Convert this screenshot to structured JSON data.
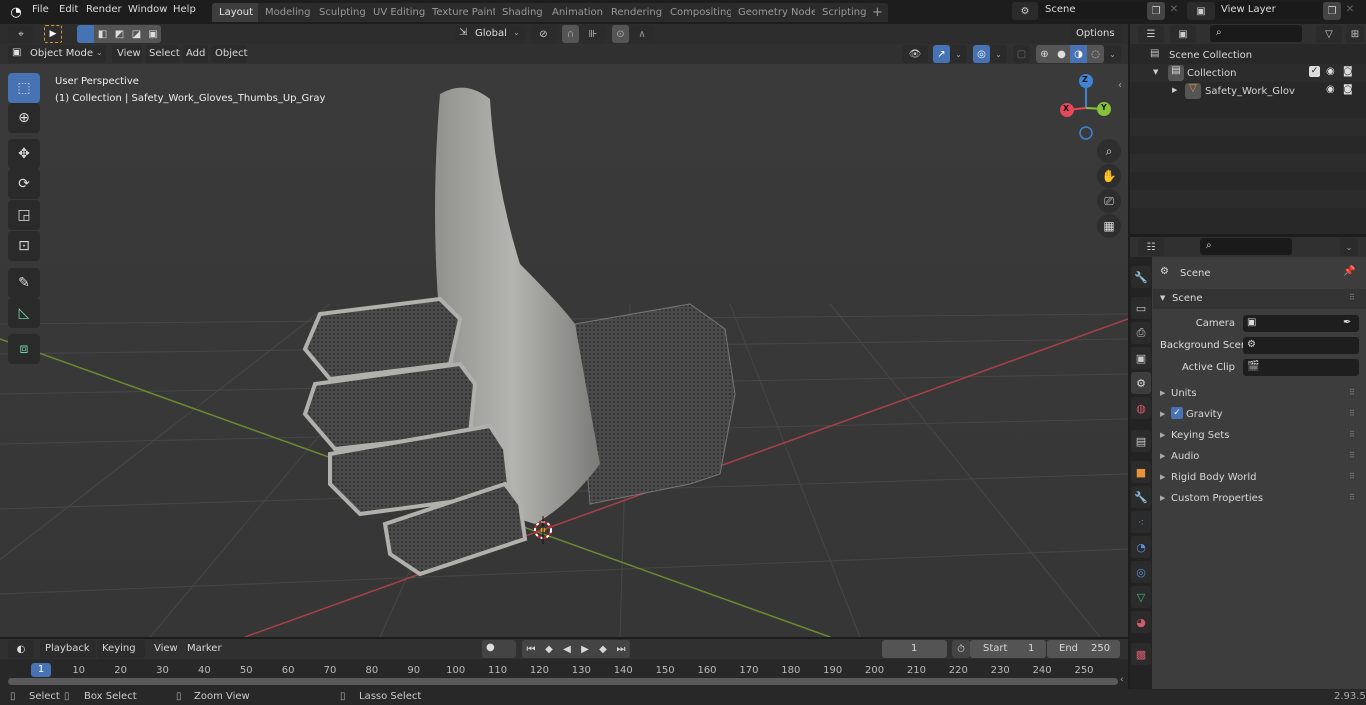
{
  "topbar": {
    "menus": [
      "File",
      "Edit",
      "Render",
      "Window",
      "Help"
    ],
    "workspaces": [
      "Layout",
      "Modeling",
      "Sculpting",
      "UV Editing",
      "Texture Paint",
      "Shading",
      "Animation",
      "Rendering",
      "Compositing",
      "Geometry Nodes",
      "Scripting"
    ],
    "active_workspace": "Layout",
    "add_workspace": "+",
    "scene_name": "Scene",
    "view_layer_name": "View Layer"
  },
  "viewport_header": {
    "mode": "Object Mode",
    "menus": [
      "View",
      "Select",
      "Add",
      "Object"
    ],
    "transform_orientation": "Global",
    "options_label": "Options"
  },
  "viewport": {
    "perspective_label": "User Perspective",
    "object_info": "(1) Collection | Safety_Work_Gloves_Thumbs_Up_Gray",
    "gizmo_axes": {
      "x": "X",
      "y": "Y",
      "z": "Z"
    },
    "colors": {
      "x_axis": "#e5475d",
      "y_axis": "#88c23a",
      "z_axis": "#3f85d6",
      "active": "#4772b3"
    }
  },
  "outliner": {
    "scene_collection": "Scene Collection",
    "collection": "Collection",
    "object": "Safety_Work_Gloves_Thu"
  },
  "properties": {
    "context_title": "Scene",
    "panel_title": "Scene",
    "fields": [
      {
        "label": "Camera",
        "value": ""
      },
      {
        "label": "Background Scene",
        "value": ""
      },
      {
        "label": "Active Clip",
        "value": ""
      }
    ],
    "subpanels": [
      {
        "label": "Units",
        "checkbox": false
      },
      {
        "label": "Gravity",
        "checkbox": true,
        "checked": true
      },
      {
        "label": "Keying Sets",
        "checkbox": false
      },
      {
        "label": "Audio",
        "checkbox": false
      },
      {
        "label": "Rigid Body World",
        "checkbox": false
      },
      {
        "label": "Custom Properties",
        "checkbox": false
      }
    ]
  },
  "timeline": {
    "menus": [
      "Playback",
      "Keying",
      "View",
      "Marker"
    ],
    "current_frame": "1",
    "start_label": "Start",
    "start": "1",
    "end_label": "End",
    "end": "250",
    "ticks": [
      "10",
      "20",
      "30",
      "40",
      "50",
      "60",
      "70",
      "80",
      "90",
      "100",
      "110",
      "120",
      "130",
      "140",
      "150",
      "160",
      "170",
      "180",
      "190",
      "200",
      "210",
      "220",
      "230",
      "240",
      "250"
    ],
    "playhead": "1"
  },
  "statusbar": {
    "hints": [
      "Select",
      "Box Select",
      "Zoom View",
      "Lasso Select"
    ],
    "version": "2.93.5"
  }
}
